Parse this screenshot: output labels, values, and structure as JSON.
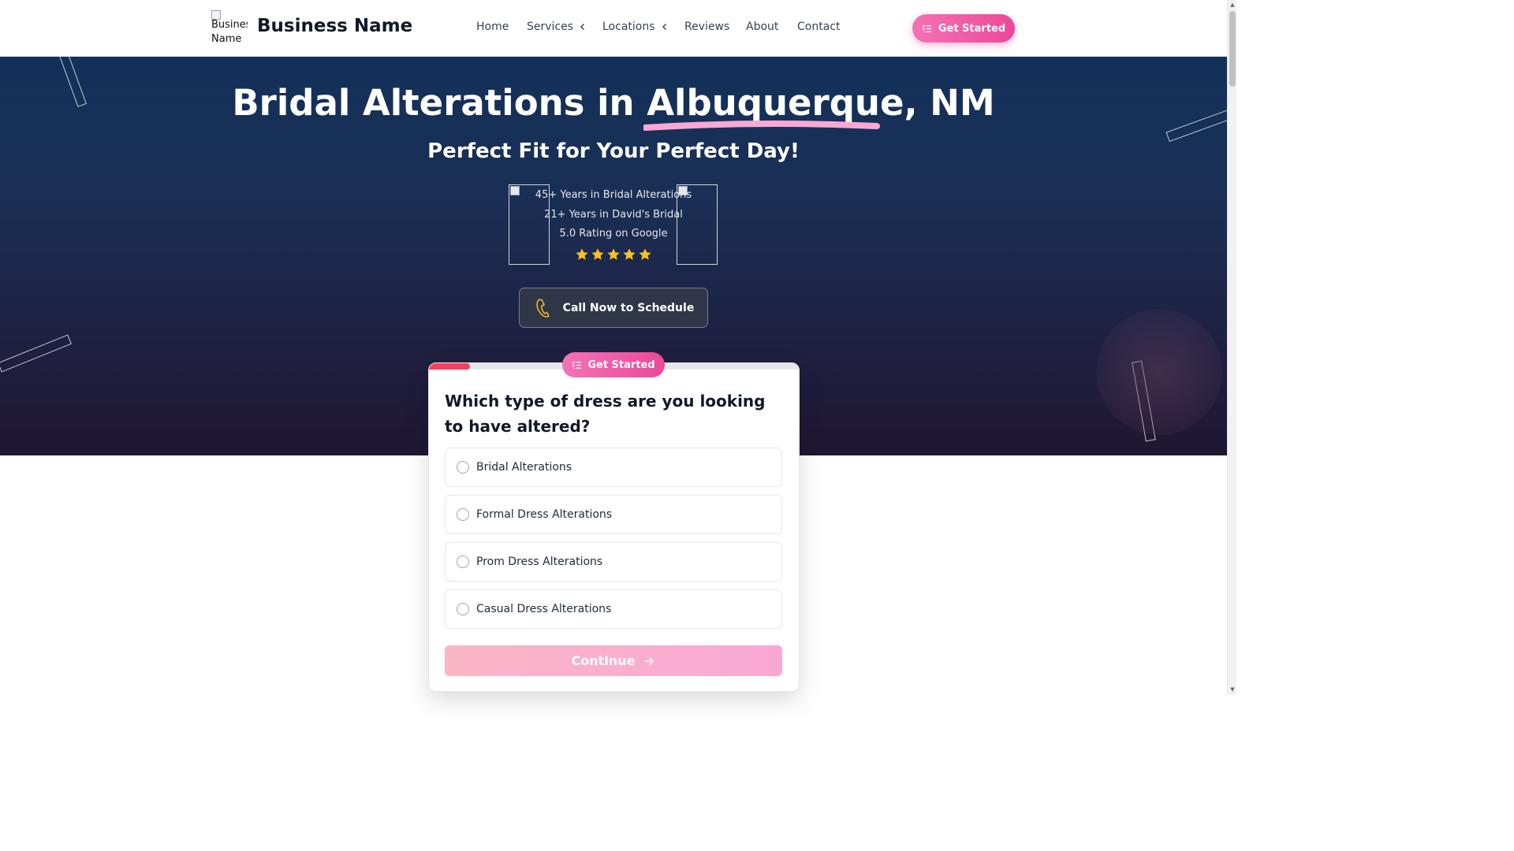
{
  "header": {
    "logo_alt": "Business Name",
    "brand": "Business Name",
    "nav": [
      {
        "label": "Home"
      },
      {
        "label": "Services"
      },
      {
        "label": "Locations"
      },
      {
        "label": "Reviews"
      },
      {
        "label": "About"
      },
      {
        "label": "Contact"
      }
    ],
    "cta": "Get Started"
  },
  "hero": {
    "title_pre": "Bridal Alterations in ",
    "title_city": "Albuquerque",
    "title_post": ", NM",
    "subtitle": "Perfect Fit for Your Perfect Day!",
    "stats": [
      "45+ Years in Bridal Alterations",
      "21+ Years in David's Bridal",
      "5.0 Rating on Google"
    ],
    "rating_stars": 5,
    "call_button": "Call Now to Schedule"
  },
  "form": {
    "badge": "Get Started",
    "progress": 0.11,
    "question": "Which type of dress are you looking to have altered?",
    "options": [
      {
        "label": "Bridal Alterations"
      },
      {
        "label": "Formal Dress Alterations"
      },
      {
        "label": "Prom Dress Alterations"
      },
      {
        "label": "Casual Dress Alterations"
      }
    ],
    "continue": "Continue"
  },
  "colors": {
    "accent_pink": "#ec4899",
    "hero_dark": "#1a2f55",
    "star": "#fbbf24"
  }
}
